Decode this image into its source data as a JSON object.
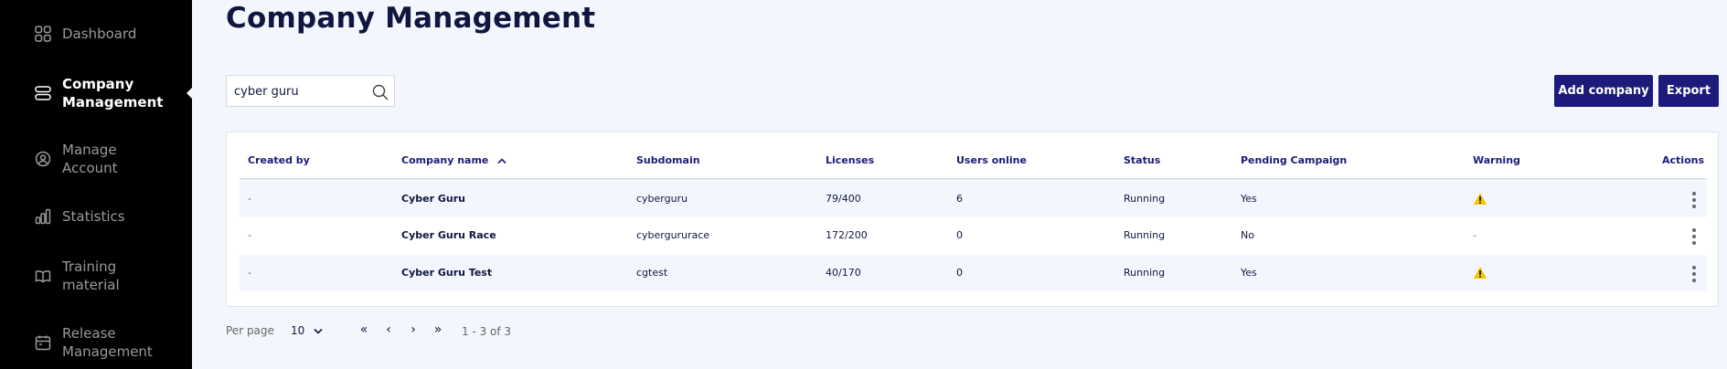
{
  "sidebar": {
    "items": [
      {
        "label": "Dashboard",
        "icon": "dashboard-icon",
        "active": false
      },
      {
        "label": "Company\nManagement",
        "icon": "company-icon",
        "active": true
      },
      {
        "label": "Manage\nAccount",
        "icon": "account-icon",
        "active": false
      },
      {
        "label": "Statistics",
        "icon": "statistics-icon",
        "active": false
      },
      {
        "label": "Training\nmaterial",
        "icon": "book-icon",
        "active": false
      },
      {
        "label": "Release\nManagement",
        "icon": "calendar-icon",
        "active": false
      }
    ]
  },
  "page": {
    "title": "Company Management"
  },
  "search": {
    "value": "cyber guru",
    "placeholder": ""
  },
  "actions": {
    "add_company": "Add company",
    "export": "Export"
  },
  "table": {
    "columns": [
      "Created by",
      "Company name",
      "Subdomain",
      "Licenses",
      "Users online",
      "Status",
      "Pending Campaign",
      "Warning",
      "Actions"
    ],
    "rows": [
      {
        "created_by": "-",
        "company_name": "Cyber Guru",
        "subdomain": "cyberguru",
        "licenses": "79/400",
        "users_online": "6",
        "status": "Running",
        "pending_campaign": "Yes",
        "warning": "warning-icon"
      },
      {
        "created_by": "-",
        "company_name": "Cyber Guru Race",
        "subdomain": "cybergururace",
        "licenses": "172/200",
        "users_online": "0",
        "status": "Running",
        "pending_campaign": "No",
        "warning": "-"
      },
      {
        "created_by": "-",
        "company_name": "Cyber Guru Test",
        "subdomain": "cgtest",
        "licenses": "40/170",
        "users_online": "0",
        "status": "Running",
        "pending_campaign": "Yes",
        "warning": "warning-icon"
      }
    ]
  },
  "pagination": {
    "per_page_label": "Per page",
    "per_page_value": "10",
    "first": "«",
    "prev": "‹",
    "next": "›",
    "last": "»",
    "range": "1 - 3 of 3"
  },
  "colors": {
    "sidebar_bg": "#000000",
    "accent": "#1c1a7a",
    "page_bg": "#f3f7fd",
    "warning": "#f2c500"
  }
}
